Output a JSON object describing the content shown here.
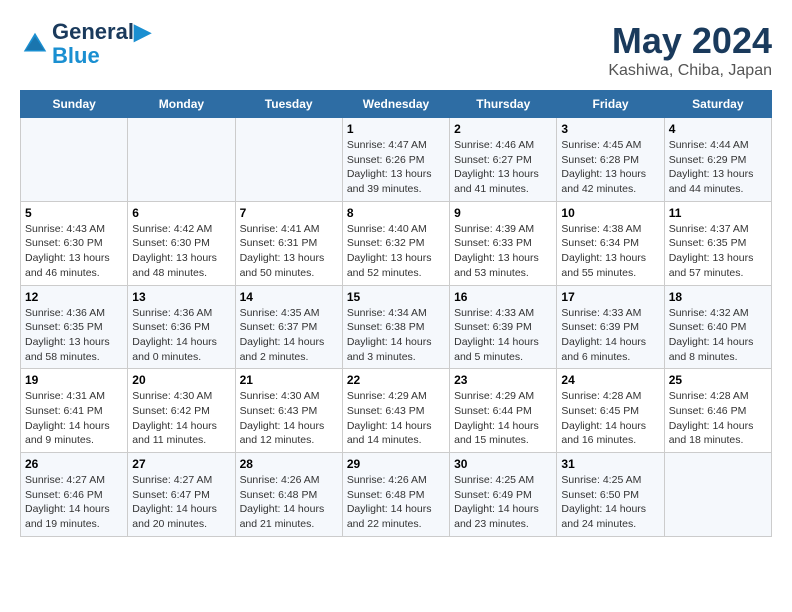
{
  "header": {
    "logo_line1": "General",
    "logo_line2": "Blue",
    "month": "May 2024",
    "location": "Kashiwa, Chiba, Japan"
  },
  "weekdays": [
    "Sunday",
    "Monday",
    "Tuesday",
    "Wednesday",
    "Thursday",
    "Friday",
    "Saturday"
  ],
  "weeks": [
    [
      {
        "day": "",
        "info": ""
      },
      {
        "day": "",
        "info": ""
      },
      {
        "day": "",
        "info": ""
      },
      {
        "day": "1",
        "info": "Sunrise: 4:47 AM\nSunset: 6:26 PM\nDaylight: 13 hours and 39 minutes."
      },
      {
        "day": "2",
        "info": "Sunrise: 4:46 AM\nSunset: 6:27 PM\nDaylight: 13 hours and 41 minutes."
      },
      {
        "day": "3",
        "info": "Sunrise: 4:45 AM\nSunset: 6:28 PM\nDaylight: 13 hours and 42 minutes."
      },
      {
        "day": "4",
        "info": "Sunrise: 4:44 AM\nSunset: 6:29 PM\nDaylight: 13 hours and 44 minutes."
      }
    ],
    [
      {
        "day": "5",
        "info": "Sunrise: 4:43 AM\nSunset: 6:30 PM\nDaylight: 13 hours and 46 minutes."
      },
      {
        "day": "6",
        "info": "Sunrise: 4:42 AM\nSunset: 6:30 PM\nDaylight: 13 hours and 48 minutes."
      },
      {
        "day": "7",
        "info": "Sunrise: 4:41 AM\nSunset: 6:31 PM\nDaylight: 13 hours and 50 minutes."
      },
      {
        "day": "8",
        "info": "Sunrise: 4:40 AM\nSunset: 6:32 PM\nDaylight: 13 hours and 52 minutes."
      },
      {
        "day": "9",
        "info": "Sunrise: 4:39 AM\nSunset: 6:33 PM\nDaylight: 13 hours and 53 minutes."
      },
      {
        "day": "10",
        "info": "Sunrise: 4:38 AM\nSunset: 6:34 PM\nDaylight: 13 hours and 55 minutes."
      },
      {
        "day": "11",
        "info": "Sunrise: 4:37 AM\nSunset: 6:35 PM\nDaylight: 13 hours and 57 minutes."
      }
    ],
    [
      {
        "day": "12",
        "info": "Sunrise: 4:36 AM\nSunset: 6:35 PM\nDaylight: 13 hours and 58 minutes."
      },
      {
        "day": "13",
        "info": "Sunrise: 4:36 AM\nSunset: 6:36 PM\nDaylight: 14 hours and 0 minutes."
      },
      {
        "day": "14",
        "info": "Sunrise: 4:35 AM\nSunset: 6:37 PM\nDaylight: 14 hours and 2 minutes."
      },
      {
        "day": "15",
        "info": "Sunrise: 4:34 AM\nSunset: 6:38 PM\nDaylight: 14 hours and 3 minutes."
      },
      {
        "day": "16",
        "info": "Sunrise: 4:33 AM\nSunset: 6:39 PM\nDaylight: 14 hours and 5 minutes."
      },
      {
        "day": "17",
        "info": "Sunrise: 4:33 AM\nSunset: 6:39 PM\nDaylight: 14 hours and 6 minutes."
      },
      {
        "day": "18",
        "info": "Sunrise: 4:32 AM\nSunset: 6:40 PM\nDaylight: 14 hours and 8 minutes."
      }
    ],
    [
      {
        "day": "19",
        "info": "Sunrise: 4:31 AM\nSunset: 6:41 PM\nDaylight: 14 hours and 9 minutes."
      },
      {
        "day": "20",
        "info": "Sunrise: 4:30 AM\nSunset: 6:42 PM\nDaylight: 14 hours and 11 minutes."
      },
      {
        "day": "21",
        "info": "Sunrise: 4:30 AM\nSunset: 6:43 PM\nDaylight: 14 hours and 12 minutes."
      },
      {
        "day": "22",
        "info": "Sunrise: 4:29 AM\nSunset: 6:43 PM\nDaylight: 14 hours and 14 minutes."
      },
      {
        "day": "23",
        "info": "Sunrise: 4:29 AM\nSunset: 6:44 PM\nDaylight: 14 hours and 15 minutes."
      },
      {
        "day": "24",
        "info": "Sunrise: 4:28 AM\nSunset: 6:45 PM\nDaylight: 14 hours and 16 minutes."
      },
      {
        "day": "25",
        "info": "Sunrise: 4:28 AM\nSunset: 6:46 PM\nDaylight: 14 hours and 18 minutes."
      }
    ],
    [
      {
        "day": "26",
        "info": "Sunrise: 4:27 AM\nSunset: 6:46 PM\nDaylight: 14 hours and 19 minutes."
      },
      {
        "day": "27",
        "info": "Sunrise: 4:27 AM\nSunset: 6:47 PM\nDaylight: 14 hours and 20 minutes."
      },
      {
        "day": "28",
        "info": "Sunrise: 4:26 AM\nSunset: 6:48 PM\nDaylight: 14 hours and 21 minutes."
      },
      {
        "day": "29",
        "info": "Sunrise: 4:26 AM\nSunset: 6:48 PM\nDaylight: 14 hours and 22 minutes."
      },
      {
        "day": "30",
        "info": "Sunrise: 4:25 AM\nSunset: 6:49 PM\nDaylight: 14 hours and 23 minutes."
      },
      {
        "day": "31",
        "info": "Sunrise: 4:25 AM\nSunset: 6:50 PM\nDaylight: 14 hours and 24 minutes."
      },
      {
        "day": "",
        "info": ""
      }
    ]
  ]
}
